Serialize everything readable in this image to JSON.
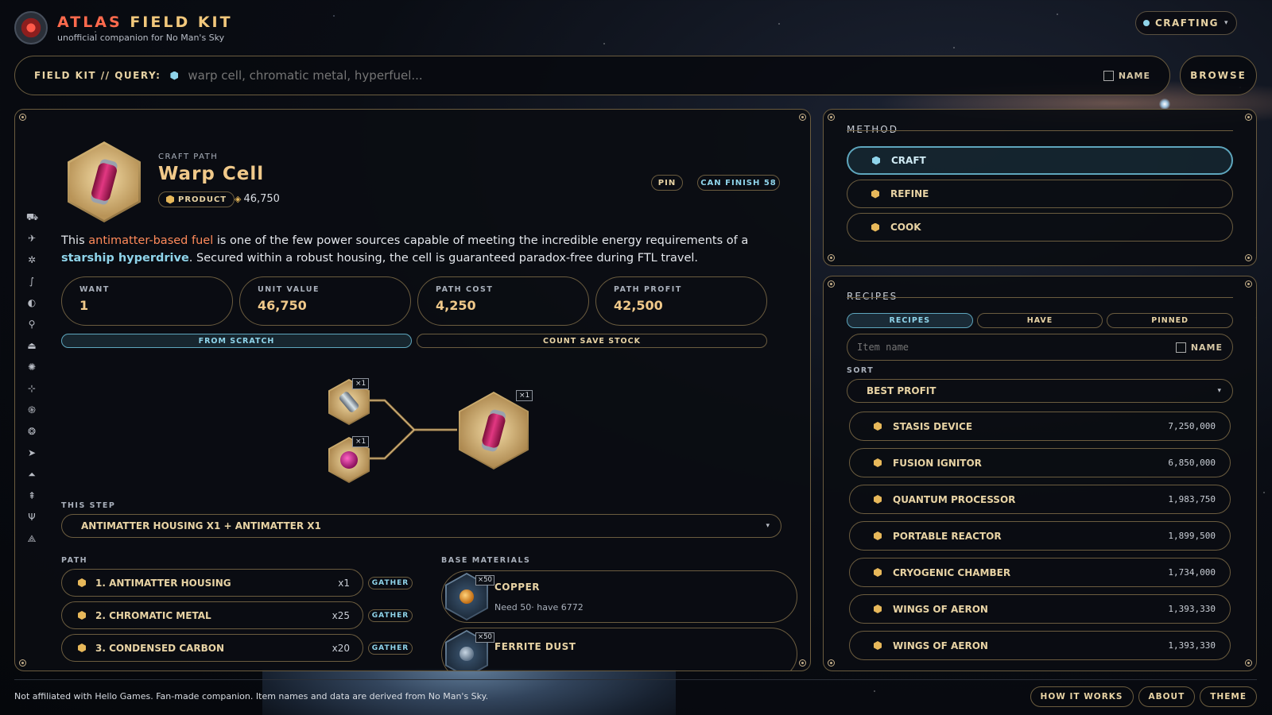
{
  "brand": {
    "title_part1": "ATLAS",
    "title_part2": "FIELD KIT",
    "subtitle": "unofficial companion for No Man's Sky"
  },
  "mode": {
    "label": "CRAFTING"
  },
  "search": {
    "label": "FIELD KIT // QUERY:",
    "placeholder": "warp cell, chromatic metal, hyperfuel...",
    "name_toggle": "NAME",
    "browse_label": "BROWSE"
  },
  "item": {
    "eyebrow": "CRAFT PATH",
    "title": "Warp Cell",
    "badge": "PRODUCT",
    "price": "46,750",
    "pin_label": "PIN",
    "finish_label": "CAN FINISH 58",
    "description_pre": "This ",
    "description_hl1": "antimatter-based fuel",
    "description_mid": " is one of the few power sources capable of meeting the incredible energy requirements of a ",
    "description_hl2": "starship hyperdrive",
    "description_post": ". Secured within a robust housing, the cell is guaranteed paradox-free during FTL travel."
  },
  "stats": [
    {
      "label": "WANT",
      "value": "1"
    },
    {
      "label": "UNIT VALUE",
      "value": "46,750"
    },
    {
      "label": "PATH COST",
      "value": "4,250"
    },
    {
      "label": "PATH PROFIT",
      "value": "42,500"
    }
  ],
  "toggles": {
    "from_scratch": "FROM SCRATCH",
    "count_stock": "COUNT SAVE STOCK"
  },
  "tree": {
    "input1_qty": "×1",
    "input2_qty": "×1",
    "output_qty": "×1"
  },
  "step": {
    "label": "THIS STEP",
    "value": "ANTIMATTER HOUSING X1 + ANTIMATTER X1"
  },
  "path": {
    "label": "PATH",
    "items": [
      {
        "name": "1. ANTIMATTER HOUSING",
        "qty": "x1",
        "action": "GATHER"
      },
      {
        "name": "2. CHROMATIC METAL",
        "qty": "x25",
        "action": "GATHER"
      },
      {
        "name": "3. CONDENSED CARBON",
        "qty": "x20",
        "action": "GATHER"
      }
    ]
  },
  "base": {
    "label": "BASE MATERIALS",
    "items": [
      {
        "name": "COPPER",
        "qty": "×50",
        "note": "Need 50· have 6772",
        "color": "#e49a2a"
      },
      {
        "name": "FERRITE DUST",
        "qty": "×50",
        "note": "",
        "color": "#8aa0b6"
      }
    ]
  },
  "method": {
    "title": "METHOD",
    "options": [
      {
        "label": "CRAFT",
        "active": true
      },
      {
        "label": "REFINE",
        "active": false
      },
      {
        "label": "COOK",
        "active": false
      }
    ]
  },
  "recipes": {
    "title": "RECIPES",
    "tabs": [
      "RECIPES",
      "HAVE",
      "PINNED"
    ],
    "search_placeholder": "Item name",
    "name_toggle": "NAME",
    "sort_label": "SORT",
    "sort_value": "BEST PROFIT",
    "items": [
      {
        "name": "STASIS DEVICE",
        "value": "7,250,000"
      },
      {
        "name": "FUSION IGNITOR",
        "value": "6,850,000"
      },
      {
        "name": "QUANTUM PROCESSOR",
        "value": "1,983,750"
      },
      {
        "name": "PORTABLE REACTOR",
        "value": "1,899,500"
      },
      {
        "name": "CRYOGENIC CHAMBER",
        "value": "1,734,000"
      },
      {
        "name": "WINGS OF AERON",
        "value": "1,393,330"
      },
      {
        "name": "WINGS OF AERON",
        "value": "1,393,330"
      }
    ]
  },
  "footer": {
    "disclaimer": "Not affiliated with Hello Games. Fan-made companion. Item names and data are derived from No Man's Sky.",
    "links": [
      "HOW IT WORKS",
      "ABOUT",
      "THEME"
    ]
  },
  "colors": {
    "gold": "#f0c98a",
    "cyan": "#8fd4ea",
    "border": "#6b5c3f",
    "accent_orange": "#ff6a4d"
  },
  "rail_icons": [
    "exocraft-icon",
    "starship-icon",
    "freighter-icon",
    "creature-icon",
    "planet-icon",
    "pin-icon",
    "base-icon",
    "bug-icon",
    "fighter-icon",
    "vortex-icon",
    "cube-icon",
    "interceptor-icon",
    "rocket-icon",
    "shuttle-icon",
    "antenna-icon",
    "pyramid-icon"
  ]
}
